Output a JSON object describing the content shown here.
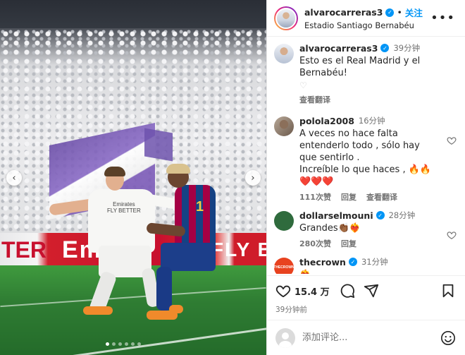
{
  "post": {
    "username": "alvarocarreras3",
    "verified_mark": "✓",
    "separator": "•",
    "follow_label": "关注",
    "location": "Estadio Santiago Bernabéu",
    "more_label": "•••",
    "image": {
      "ad_left": "TER",
      "ad_mid": "Emir",
      "ad_right": "FLY BE",
      "jersey_sponsor": "Emirates\nFLY BETTER",
      "player_number": "1",
      "prev_arrow": "‹",
      "next_arrow": "›",
      "carousel_count": 6,
      "carousel_active": 1
    }
  },
  "comments": [
    {
      "user": "alvarocarreras3",
      "verified": true,
      "time": "39分钟",
      "text": "Esto es el Real Madrid y el Bernabéu!",
      "extra": "♡",
      "meta": [
        "查看翻译"
      ],
      "avatar": "av-alvaro"
    },
    {
      "user": "polola2008",
      "verified": false,
      "time": "16分钟",
      "text": "A veces no hace falta entenderlo todo , sólo hay que sentirlo .\nIncreíble lo que haces , 🔥🔥❤️❤️❤️",
      "meta": [
        "111次赞",
        "回复",
        "查看翻译"
      ],
      "avatar": "av-polola",
      "like_icon": "heart-icon"
    },
    {
      "user": "dollarselmouni",
      "verified": true,
      "time": "28分钟",
      "text": "Grandes👏🏾❤️‍🔥",
      "meta": [
        "280次赞",
        "回复"
      ],
      "avatar": "av-dollar",
      "like_icon": "heart-icon"
    },
    {
      "user": "thecrown",
      "verified": true,
      "time": "31分钟",
      "text": "❤️‍🔥",
      "meta": [],
      "avatar": "av-crown",
      "avatar_text": "THECROWN",
      "like_icon": "heart-icon"
    }
  ],
  "actions": {
    "likes": "15.4 万",
    "post_time": "39分钟前",
    "icons": [
      "heart-icon",
      "comment-icon",
      "share-icon",
      "bookmark-icon"
    ]
  },
  "composer": {
    "placeholder": "添加评论...",
    "emoji_icon": "emoji-icon"
  },
  "colors": {
    "accent": "#0095f6",
    "text": "#262626",
    "muted": "#737373"
  }
}
